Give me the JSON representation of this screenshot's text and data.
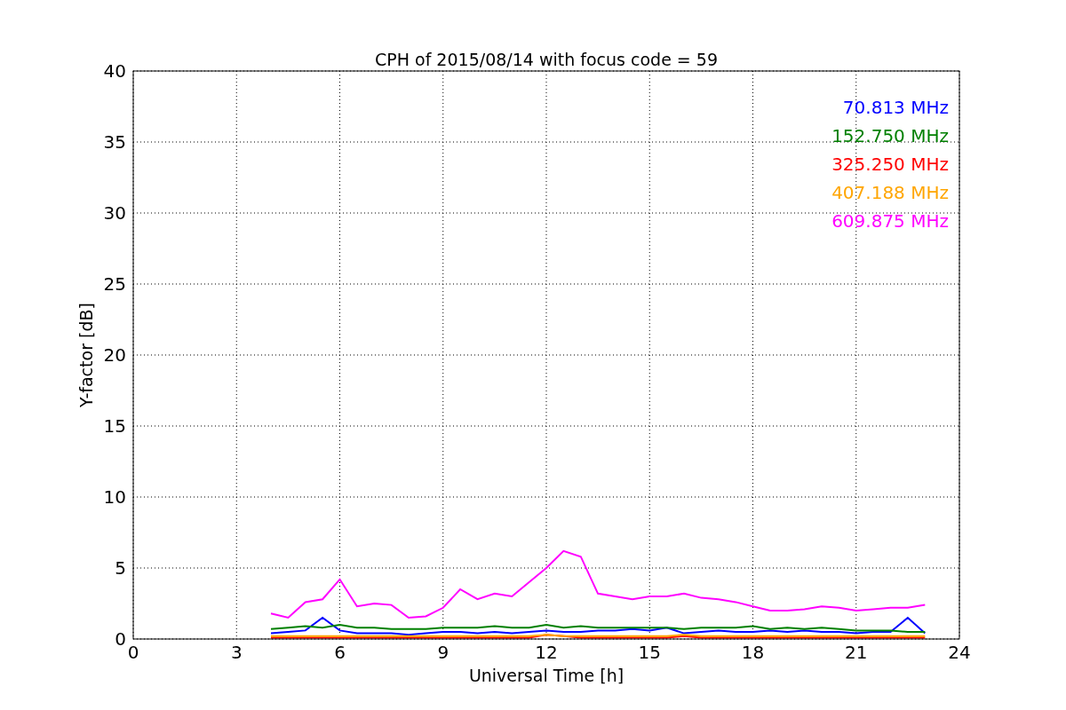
{
  "chart_data": {
    "type": "line",
    "title": "CPH of 2015/08/14 with focus code = 59",
    "xlabel": "Universal Time [h]",
    "ylabel": "Y-factor [dB]",
    "x": [
      4,
      4.5,
      5,
      5.5,
      6,
      6.5,
      7,
      7.5,
      8,
      8.5,
      9,
      9.5,
      10,
      10.5,
      11,
      11.5,
      12,
      12.5,
      13,
      13.5,
      14,
      14.5,
      15,
      15.5,
      16,
      16.5,
      17,
      17.5,
      18,
      18.5,
      19,
      19.5,
      20,
      20.5,
      21,
      21.5,
      22,
      22.5,
      23
    ],
    "series": [
      {
        "name": "70.813 MHz",
        "color": "#0000ff",
        "values": [
          0.4,
          0.5,
          0.6,
          1.5,
          0.6,
          0.4,
          0.4,
          0.4,
          0.3,
          0.4,
          0.5,
          0.5,
          0.4,
          0.5,
          0.4,
          0.5,
          0.6,
          0.5,
          0.5,
          0.6,
          0.6,
          0.7,
          0.6,
          0.8,
          0.4,
          0.5,
          0.6,
          0.5,
          0.5,
          0.6,
          0.5,
          0.6,
          0.5,
          0.5,
          0.4,
          0.5,
          0.5,
          1.5,
          0.4
        ]
      },
      {
        "name": "152.750 MHz",
        "color": "#008000",
        "values": [
          0.7,
          0.8,
          0.9,
          0.8,
          1.0,
          0.8,
          0.8,
          0.7,
          0.7,
          0.7,
          0.8,
          0.8,
          0.8,
          0.9,
          0.8,
          0.8,
          1.0,
          0.8,
          0.9,
          0.8,
          0.8,
          0.8,
          0.8,
          0.8,
          0.7,
          0.8,
          0.8,
          0.8,
          0.9,
          0.7,
          0.8,
          0.7,
          0.8,
          0.7,
          0.6,
          0.6,
          0.6,
          0.5,
          0.5
        ]
      },
      {
        "name": "325.250 MHz",
        "color": "#ff0000",
        "values": [
          0.1,
          0.1,
          0.1,
          0.1,
          0.1,
          0.1,
          0.1,
          0.1,
          0.1,
          0.1,
          0.1,
          0.1,
          0.1,
          0.1,
          0.1,
          0.1,
          0.3,
          0.2,
          0.1,
          0.1,
          0.1,
          0.1,
          0.1,
          0.1,
          0.2,
          0.1,
          0.1,
          0.1,
          0.1,
          0.1,
          0.1,
          0.1,
          0.1,
          0.1,
          0.1,
          0.1,
          0.1,
          0.1,
          0.1
        ]
      },
      {
        "name": "407.188 MHz",
        "color": "#ffa500",
        "values": [
          0.2,
          0.2,
          0.2,
          0.2,
          0.2,
          0.2,
          0.2,
          0.2,
          0.2,
          0.2,
          0.2,
          0.2,
          0.2,
          0.2,
          0.2,
          0.2,
          0.3,
          0.2,
          0.2,
          0.2,
          0.2,
          0.2,
          0.2,
          0.2,
          0.3,
          0.2,
          0.2,
          0.2,
          0.2,
          0.2,
          0.2,
          0.2,
          0.2,
          0.2,
          0.2,
          0.2,
          0.2,
          0.2,
          0.2
        ]
      },
      {
        "name": "609.875 MHz",
        "color": "#ff00ff",
        "values": [
          1.8,
          1.5,
          2.6,
          2.8,
          4.2,
          2.3,
          2.5,
          2.4,
          1.5,
          1.6,
          2.2,
          3.5,
          2.8,
          3.2,
          3.0,
          4.0,
          5.0,
          6.2,
          5.8,
          3.2,
          3.0,
          2.8,
          3.0,
          3.0,
          3.2,
          2.9,
          2.8,
          2.6,
          2.3,
          2.0,
          2.0,
          2.1,
          2.3,
          2.2,
          2.0,
          2.1,
          2.2,
          2.2,
          2.4
        ]
      }
    ],
    "grid": true,
    "xlim": [
      0,
      24
    ],
    "ylim": [
      0,
      40
    ],
    "xticks": [
      0,
      3,
      6,
      9,
      12,
      15,
      18,
      21,
      24
    ],
    "yticks": [
      0,
      5,
      10,
      15,
      20,
      25,
      30,
      35,
      40
    ]
  }
}
